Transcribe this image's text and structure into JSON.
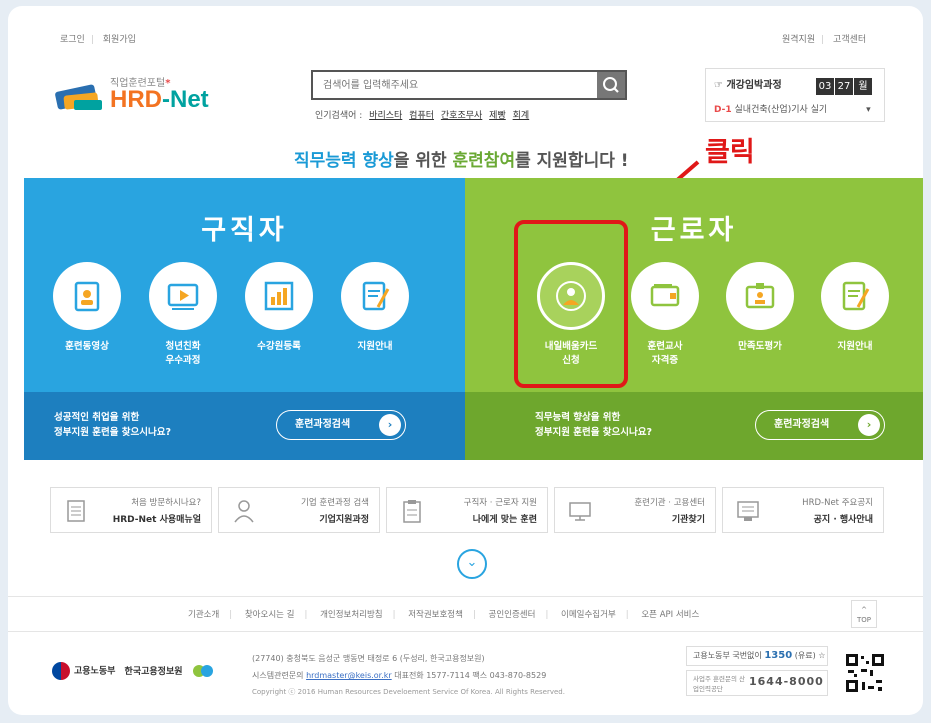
{
  "header": {
    "util_left": [
      "로그인",
      "회원가입"
    ],
    "util_right": [
      "원격지원",
      "고객센터"
    ]
  },
  "logo": {
    "tagline": "직업훈련포털",
    "tagline_mark": "*",
    "brand_hrd": "HRD",
    "brand_net": "-Net"
  },
  "search": {
    "placeholder": "검색어를 입력해주세요",
    "popular_label": "인기검색어 :",
    "popular_keywords": [
      "바리스타",
      "컴퓨터",
      "간호조무사",
      "제빵",
      "회계"
    ]
  },
  "countdown": {
    "title": "개강임박과정",
    "digits": [
      "03",
      "27",
      "월"
    ],
    "course_dday": "D-1",
    "course_name": "실내건축(산업)기사 실기"
  },
  "headline": {
    "p1": "직무능력 향상",
    "p2": "을 위한 ",
    "p3": "훈련참여",
    "p4": "를 지원합니다 !"
  },
  "annotation": {
    "click_label": "클릭"
  },
  "left_panel": {
    "title": "구직자",
    "services": [
      {
        "l1": "훈련동영상",
        "l2": ""
      },
      {
        "l1": "청년친화",
        "l2": "우수과정"
      },
      {
        "l1": "수강원등록",
        "l2": ""
      },
      {
        "l1": "지원안내",
        "l2": ""
      }
    ],
    "bottom_l1": "성공적인 취업을 위한",
    "bottom_l2": "정부지원 훈련을 찾으시나요?",
    "button": "훈련과정검색"
  },
  "right_panel": {
    "title": "근로자",
    "services": [
      {
        "l1": "내일배움카드",
        "l2": "신청"
      },
      {
        "l1": "훈련교사",
        "l2": "자격증"
      },
      {
        "l1": "만족도평가",
        "l2": ""
      },
      {
        "l1": "지원안내",
        "l2": ""
      }
    ],
    "bottom_l1": "직무능력 향상을 위한",
    "bottom_l2": "정부지원 훈련을 찾으시나요?",
    "button": "훈련과정검색"
  },
  "quick_links": [
    {
      "l1": "처음 방문하시나요?",
      "l2": "HRD-Net 사용매뉴얼",
      "icon": "document-icon"
    },
    {
      "l1": "기업 훈련과정 검색",
      "l2": "기업지원과정",
      "icon": "person-icon"
    },
    {
      "l1": "구직자 · 근로자 지원",
      "l2": "나에게 맞는 훈련",
      "icon": "clipboard-icon"
    },
    {
      "l1": "훈련기관 · 고용센터",
      "l2": "기관찾기",
      "icon": "monitor-icon"
    },
    {
      "l1": "HRD-Net 주요공지",
      "l2": "공지 · 행사안내",
      "icon": "notice-icon"
    }
  ],
  "footer": {
    "links": [
      "기관소개",
      "찾아오시는 길",
      "개인정보처리방침",
      "저작권보호정책",
      "공인인증센터",
      "이메일수집거부",
      "오픈 API 서비스"
    ],
    "top_label": "TOP",
    "gov1": "고용노동부",
    "gov2": "한국고용정보원",
    "addr1": "(27740) 충청북도 음성군 맹동면 태정로 6 (두성리, 한국고용정보원)",
    "addr2_pre": "시스템관련문의 ",
    "addr2_mail": "hrdmaster@keis.or.kr",
    "addr2_post": " 대표전화 1577-7114 팩스 043-870-8529",
    "copyright": "Copyright ⓒ 2016 Human Resources Develoement Service Of Korea. All Rights Reserved.",
    "call1_label": "고용노동부 국번없이",
    "call1_num": "1350",
    "call1_note": "(유료) ☆",
    "call2_label": "사업주 훈련문의 산업인력공단",
    "call2_num": "1644-8000"
  },
  "colors": {
    "seeker_blue": "#29a4e0",
    "worker_green": "#8fc43e",
    "accent_red": "#e01818",
    "brand_orange": "#f37321"
  }
}
